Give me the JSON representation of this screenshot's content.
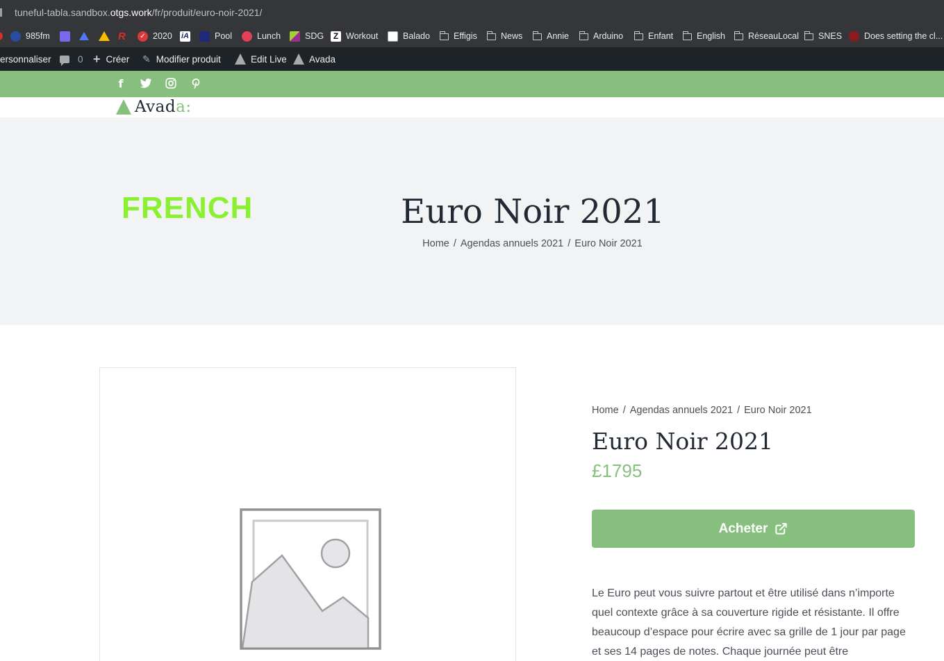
{
  "browser": {
    "url_prefix": "tuneful-tabla.sandbox.",
    "url_host": "otgs.work",
    "url_path": "/fr/produit/euro-noir-2021/"
  },
  "bookmarks": [
    {
      "label": "985fm",
      "icon": "radio-icon",
      "color": "#2b4d9f"
    },
    {
      "label": "",
      "icon": "grid-icon",
      "color": "#7a67ee"
    },
    {
      "label": "",
      "icon": "dropbox-icon",
      "color": "#4f77ff"
    },
    {
      "label": "",
      "icon": "drive-icon",
      "color": "#fbbc04"
    },
    {
      "label": "",
      "icon": "r-logo-icon",
      "color": "#d93025"
    },
    {
      "label": "2020",
      "icon": "check-circle-icon",
      "color": "#db3a3a"
    },
    {
      "label": "",
      "icon": "ia-writer-icon",
      "color": "#ffffff"
    },
    {
      "label": "Pool",
      "icon": "pool-icon",
      "color": "#1e2a78"
    },
    {
      "label": "Lunch",
      "icon": "lunch-icon",
      "color": "#e43f5a"
    },
    {
      "label": "SDG",
      "icon": "sdg-icon",
      "color": "#a6ce39"
    },
    {
      "label": "Workout",
      "icon": "z-icon",
      "color": "#ffffff"
    },
    {
      "label": "Balado",
      "icon": "balado-icon",
      "color": "#ffffff"
    },
    {
      "label": "Effigis",
      "icon": "folder-icon"
    },
    {
      "label": "News",
      "icon": "folder-icon"
    },
    {
      "label": "Annie",
      "icon": "folder-icon"
    },
    {
      "label": "Arduino",
      "icon": "folder-icon"
    },
    {
      "label": "Enfant",
      "icon": "folder-icon"
    },
    {
      "label": "English",
      "icon": "folder-icon"
    },
    {
      "label": "RéseauLocal",
      "icon": "folder-icon"
    },
    {
      "label": "SNES",
      "icon": "folder-icon"
    },
    {
      "label": "Does setting the cl...",
      "icon": "page-icon",
      "color": "#8a1c1c"
    }
  ],
  "adminbar": {
    "customize": "ersonnaliser",
    "comments_count": "0",
    "create": "Créer",
    "edit_product": "Modifier produit",
    "edit_live": "Edit Live",
    "avada": "Avada"
  },
  "social": {
    "facebook": "f",
    "icons": [
      "facebook-icon",
      "twitter-icon",
      "instagram-icon",
      "pinterest-icon"
    ]
  },
  "logo": {
    "text_main": "Avad",
    "text_accent": "a",
    "text_tail": ":"
  },
  "title_bar": {
    "language_label": "FRENCH",
    "title": "Euro Noir 2021",
    "breadcrumb": [
      "Home",
      "Agendas annuels 2021",
      "Euro Noir 2021"
    ]
  },
  "product": {
    "breadcrumb": [
      "Home",
      "Agendas annuels 2021",
      "Euro Noir 2021"
    ],
    "title": "Euro Noir 2021",
    "price": "£1795",
    "buy_label": "Acheter",
    "description": "Le Euro peut vous suivre partout et être utilisé dans n’importe quel contexte grâce à sa couverture rigide et résistante. Il offre beaucoup d’espace pour écrire avec sa grille de 1 jour par page et ses 14 pages de notes. Chaque journée peut être"
  },
  "colors": {
    "accent": "#87bf7e",
    "language_label": "#8bf031",
    "heading": "#212934",
    "admin_bar": "#1d2327"
  }
}
